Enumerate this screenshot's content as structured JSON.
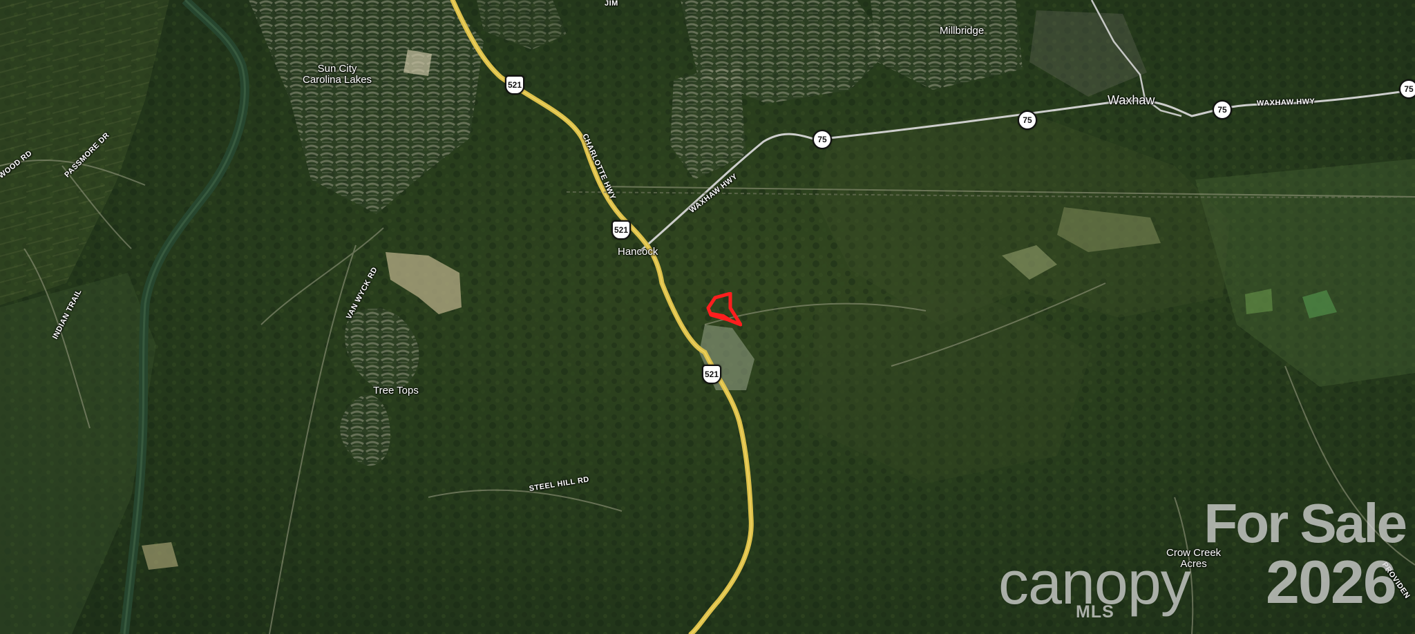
{
  "map": {
    "places": {
      "sun_city": "Sun City\nCarolina Lakes",
      "millbridge": "Millbridge",
      "waxhaw": "Waxhaw",
      "hancock": "Hancock",
      "tree_tops": "Tree Tops",
      "crow_creek": "Crow Creek\nAcres"
    },
    "roads": {
      "jim": "JIM",
      "charlotte_hwy": "CHARLOTTE HWY",
      "waxhaw_hwy_left": "WAXHAW HWY",
      "waxhaw_hwy_right": "WAXHAW HWY",
      "wood_rd": "WOOD RD",
      "passmore_dr": "PASSMORE DR",
      "van_wyck_rd": "VAN WYCK RD",
      "indian_trail": "INDIAN TRAIL",
      "steel_hill_rd": "STEEL HILL RD",
      "providence": "PROVIDEN"
    },
    "shields": {
      "us_521_top": "521",
      "us_521_mid": "521",
      "us_521_bottom": "521",
      "nc_75_a": "75",
      "nc_75_b": "75",
      "nc_75_c": "75",
      "nc_75_d": "75"
    },
    "watermark": {
      "for_sale": "For Sale",
      "brand": "canopy",
      "mls": "MLS",
      "year": "2026"
    },
    "colors": {
      "highway": "#dcc04a",
      "state_road": "#d6d6d6",
      "parcel": "#ff1e1e",
      "river": "#27472f"
    }
  }
}
